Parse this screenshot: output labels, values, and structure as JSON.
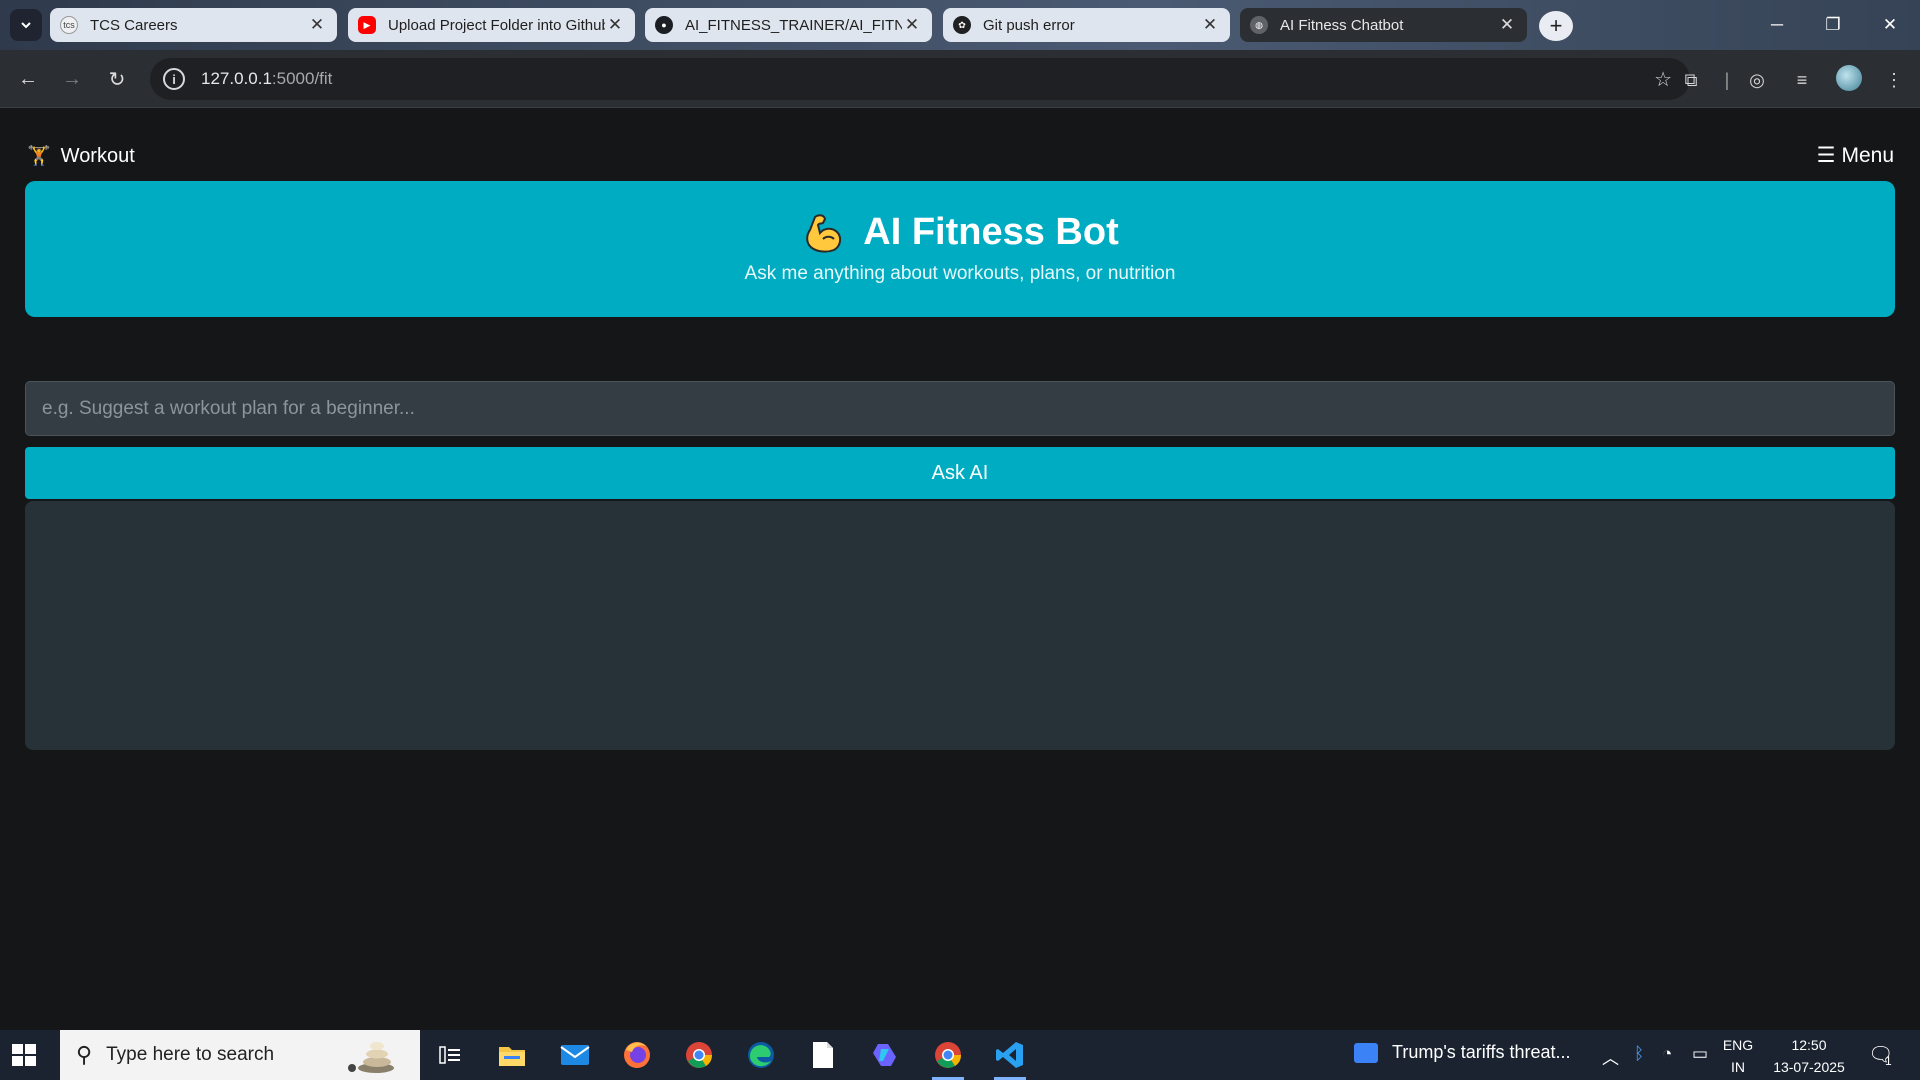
{
  "browser": {
    "tabs": [
      {
        "title": "TCS Careers",
        "favicon": "tcs-icon",
        "favicon_text": "tcs",
        "active": false
      },
      {
        "title": "Upload Project Folder into Github",
        "favicon": "youtube-icon",
        "active": false
      },
      {
        "title": "AI_FITNESS_TRAINER/AI_FITNESS",
        "favicon": "github-icon",
        "active": false
      },
      {
        "title": "Git push error",
        "favicon": "chatgpt-icon",
        "active": false
      },
      {
        "title": "AI Fitness Chatbot",
        "favicon": "globe-icon",
        "active": true
      }
    ],
    "url_host": "127.0.0.1",
    "url_path": ":5000/fit"
  },
  "page": {
    "brand": "Workout",
    "brand_icon": "dumbbell-icon",
    "menu": "Menu",
    "hero_title": "AI Fitness Bot",
    "hero_subtitle": "Ask me anything about workouts, plans, or nutrition",
    "input_placeholder": "e.g. Suggest a workout plan for a beginner...",
    "input_value": "",
    "ask_button": "Ask AI",
    "response_text": "",
    "colors": {
      "accent": "#00acc1",
      "background": "#151618",
      "input_bg": "#343d44",
      "response_bg": "#263238"
    }
  },
  "taskbar": {
    "search_placeholder": "Type here to search",
    "news": "Trump's tariffs threat...",
    "lang_top": "ENG",
    "lang_bottom": "IN",
    "time": "12:50",
    "date": "13-07-2025",
    "notification_count": "1"
  }
}
